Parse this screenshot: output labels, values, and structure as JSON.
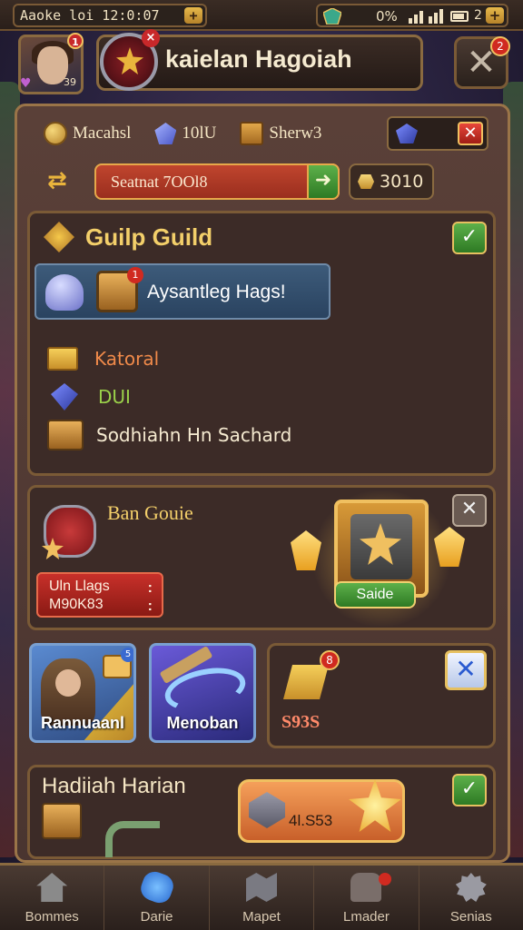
{
  "status_bar": {
    "left_text": "Aaoke loi 12:0:07",
    "battery_text": "0%",
    "right_pct": "2",
    "plus_label": "+"
  },
  "header": {
    "avatar_badge": "1",
    "avatar_level": "39",
    "title": "kaielan Hagoiah",
    "emblem_x": "×",
    "close_label": "✕",
    "close_badge": "2"
  },
  "resources": {
    "items": [
      {
        "icon": "coin-icon",
        "label": "Macahsl"
      },
      {
        "icon": "gem-icon",
        "label": "10lU"
      },
      {
        "icon": "crate-icon",
        "label": "Sherw3"
      }
    ],
    "close_label": "✕"
  },
  "search": {
    "text": "Seatnat 7OOl8",
    "go_label": "➜",
    "gold_value": "3010"
  },
  "guild": {
    "title": "Guilp Guild",
    "check": "✓",
    "banner_text": "Aysantleg Hags!",
    "banner_badge": "1",
    "list": [
      {
        "icon": "mail-icon",
        "text": "Katoral",
        "color": "#f08a4a"
      },
      {
        "icon": "gem-icon",
        "text": "DUI",
        "color": "#9ad04a"
      },
      {
        "icon": "chest-icon",
        "text": "Sodhiahn Hn Sachard",
        "color": "#f5ead0"
      }
    ]
  },
  "ban": {
    "title": "Ban Gouie",
    "stats_line1": "Uln Llags",
    "stats_line2": "M90K83",
    "close": "✕",
    "art_button": "Saide"
  },
  "tiles": [
    {
      "label": "Rannuaanl",
      "badge": "5"
    },
    {
      "label": "Menoban"
    }
  ],
  "tile_c": {
    "badge": "8",
    "value": "S93S",
    "close": "✕"
  },
  "daily": {
    "title": "Hadiiah Harian",
    "claim_text": "4l.S53",
    "check": "✓"
  },
  "nav": [
    {
      "label": "Bommes",
      "icon": "home-icon"
    },
    {
      "label": "Darie",
      "icon": "dice-icon"
    },
    {
      "label": "Mapet",
      "icon": "map-icon"
    },
    {
      "label": "Lmader",
      "icon": "bag-icon"
    },
    {
      "label": "Senias",
      "icon": "gear-icon"
    }
  ]
}
